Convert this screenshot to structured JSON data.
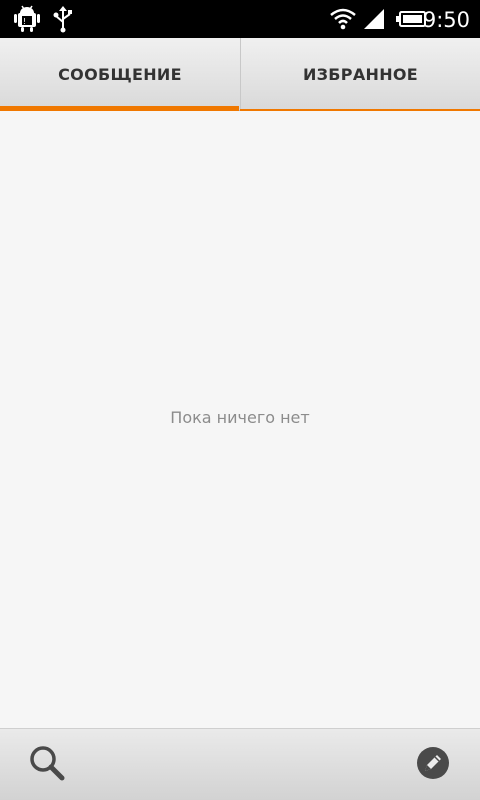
{
  "status_bar": {
    "time": "9:50",
    "icons": [
      "android-debug-icon",
      "usb-icon",
      "wifi-icon",
      "signal-icon",
      "battery-icon"
    ]
  },
  "tabs": [
    {
      "label": "СООБЩЕНИЕ",
      "active": true
    },
    {
      "label": "ИЗБРАННОЕ",
      "active": false
    }
  ],
  "content": {
    "empty_message": "Пока ничего нет"
  },
  "bottom_bar": {
    "actions": [
      "search-icon",
      "compose-icon"
    ]
  },
  "colors": {
    "accent": "#f07800",
    "status_bar_bg": "#000000",
    "background": "#f6f6f6",
    "empty_text": "#8c8c8c"
  }
}
